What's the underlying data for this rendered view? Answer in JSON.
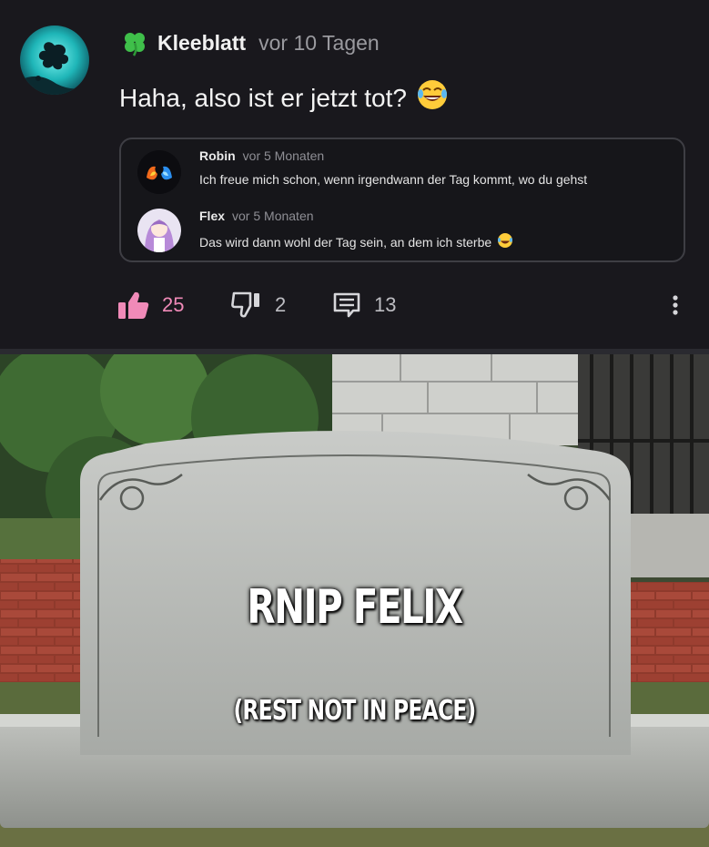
{
  "comment": {
    "author": "Kleeblatt",
    "time": "vor 10 Tagen",
    "text": "Haha, also ist er jetzt tot?",
    "emoji_icon": "laughing-tears-icon"
  },
  "quoted": [
    {
      "name": "Robin",
      "time": "vor 5 Monaten",
      "text": "Ich freue mich schon, wenn irgendwann der Tag kommt, wo du gehst"
    },
    {
      "name": "Flex",
      "time": "vor 5 Monaten",
      "text": "Das wird dann wohl der Tag sein, an dem ich sterbe"
    }
  ],
  "actions": {
    "likes": "25",
    "dislikes": "2",
    "replies": "13"
  },
  "meme": {
    "title": "RNIP FELIX",
    "subtitle": "(REST NOT IN PEACE)"
  },
  "colors": {
    "background": "#19181d",
    "like_accent": "#f08ab8",
    "muted_text": "#9a9a9f"
  }
}
